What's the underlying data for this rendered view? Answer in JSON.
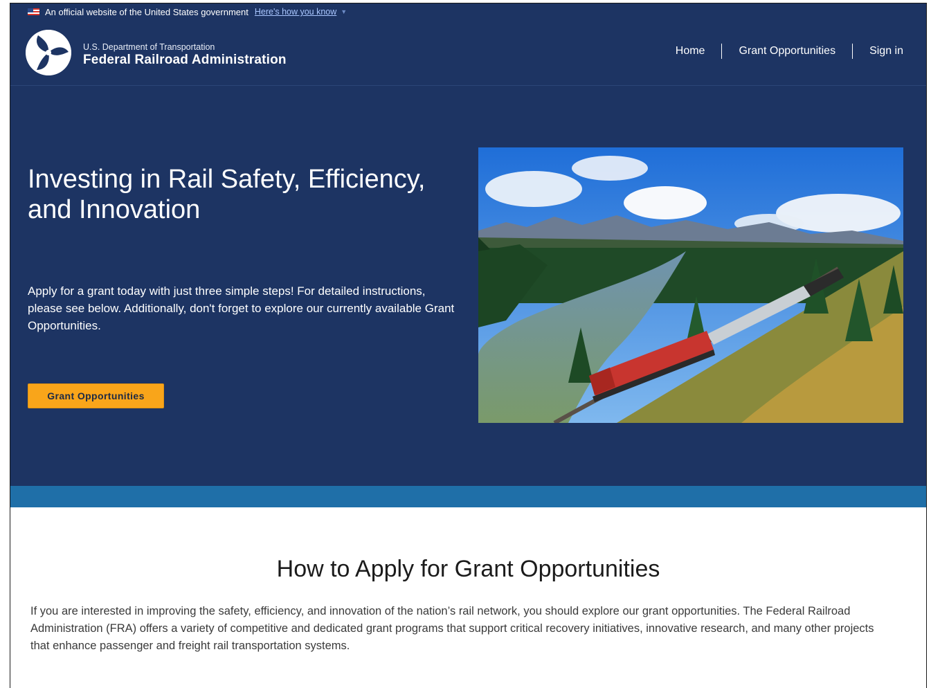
{
  "gov_banner": {
    "text": "An official website of the United States government",
    "link": "Here's how you know"
  },
  "header": {
    "dept": "U.S. Department of Transportation",
    "agency": "Federal Railroad Administration",
    "nav": [
      "Home",
      "Grant Opportunities",
      "Sign in"
    ]
  },
  "hero": {
    "title": "Investing in Rail Safety, Efficiency, and Innovation",
    "intro": "Apply for a grant today with just three simple steps! For detailed instructions, please see below. Additionally, don't forget to explore our currently available Grant Opportunities.",
    "cta": "Grant Opportunities"
  },
  "howto": {
    "heading": "How to Apply for Grant Opportunities",
    "body": "If you are interested in improving the safety, efficiency, and innovation of the nation’s rail network, you should explore our grant opportunities. The Federal Railroad Administration (FRA) offers a variety of competitive and dedicated grant programs that support critical recovery initiatives, innovative research, and many other projects that enhance passenger and freight rail transportation systems."
  },
  "colors": {
    "navy": "#1d3463",
    "stripe": "#1f6fa8",
    "cta": "#f9a51a"
  },
  "icons": {
    "flag": "us-flag-icon",
    "caret": "chevron-down-icon",
    "logo": "dot-triskelion-logo"
  }
}
